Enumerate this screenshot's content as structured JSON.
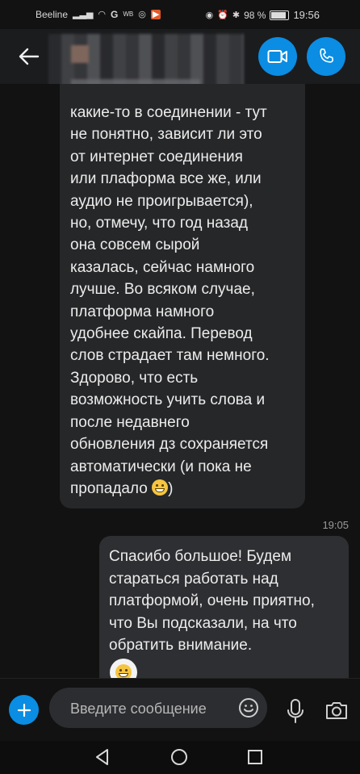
{
  "status_bar": {
    "carrier": "Beeline",
    "network_label": "G",
    "app_badge": "WB",
    "battery": "98 %",
    "time": "19:56"
  },
  "header": {
    "back_icon": "arrow-left-icon",
    "video_icon": "video-camera-icon",
    "call_icon": "phone-icon",
    "accent_color": "#0a8de3"
  },
  "messages": [
    {
      "direction": "incoming",
      "lines": [
        "какие-то в соединении - тут",
        "не понятно, зависит ли это",
        "от интернет соединения",
        "или плаформа все же, или",
        "аудио не проигрывается),",
        "но, отмечу, что год назад",
        "она совсем сырой",
        "казалась, сейчас намного",
        "лучше. Во всяком случае,",
        "платформа намного",
        "удобнее скайпа. Перевод",
        "слов страдает там немного.",
        "Здорово, что есть",
        "возможность учить слова и",
        "после недавнего",
        "обновления дз сохраняется",
        "автоматически (и пока не",
        "пропадало"
      ],
      "closing": ")"
    },
    {
      "direction": "outgoing",
      "time": "19:05",
      "lines": [
        "Спасибо большое! Будем",
        "стараться работать над",
        "платформой, очень приятно,",
        "что Вы подсказали, на что",
        "обратить внимание."
      ]
    }
  ],
  "composer": {
    "placeholder": "Введите сообщение"
  }
}
